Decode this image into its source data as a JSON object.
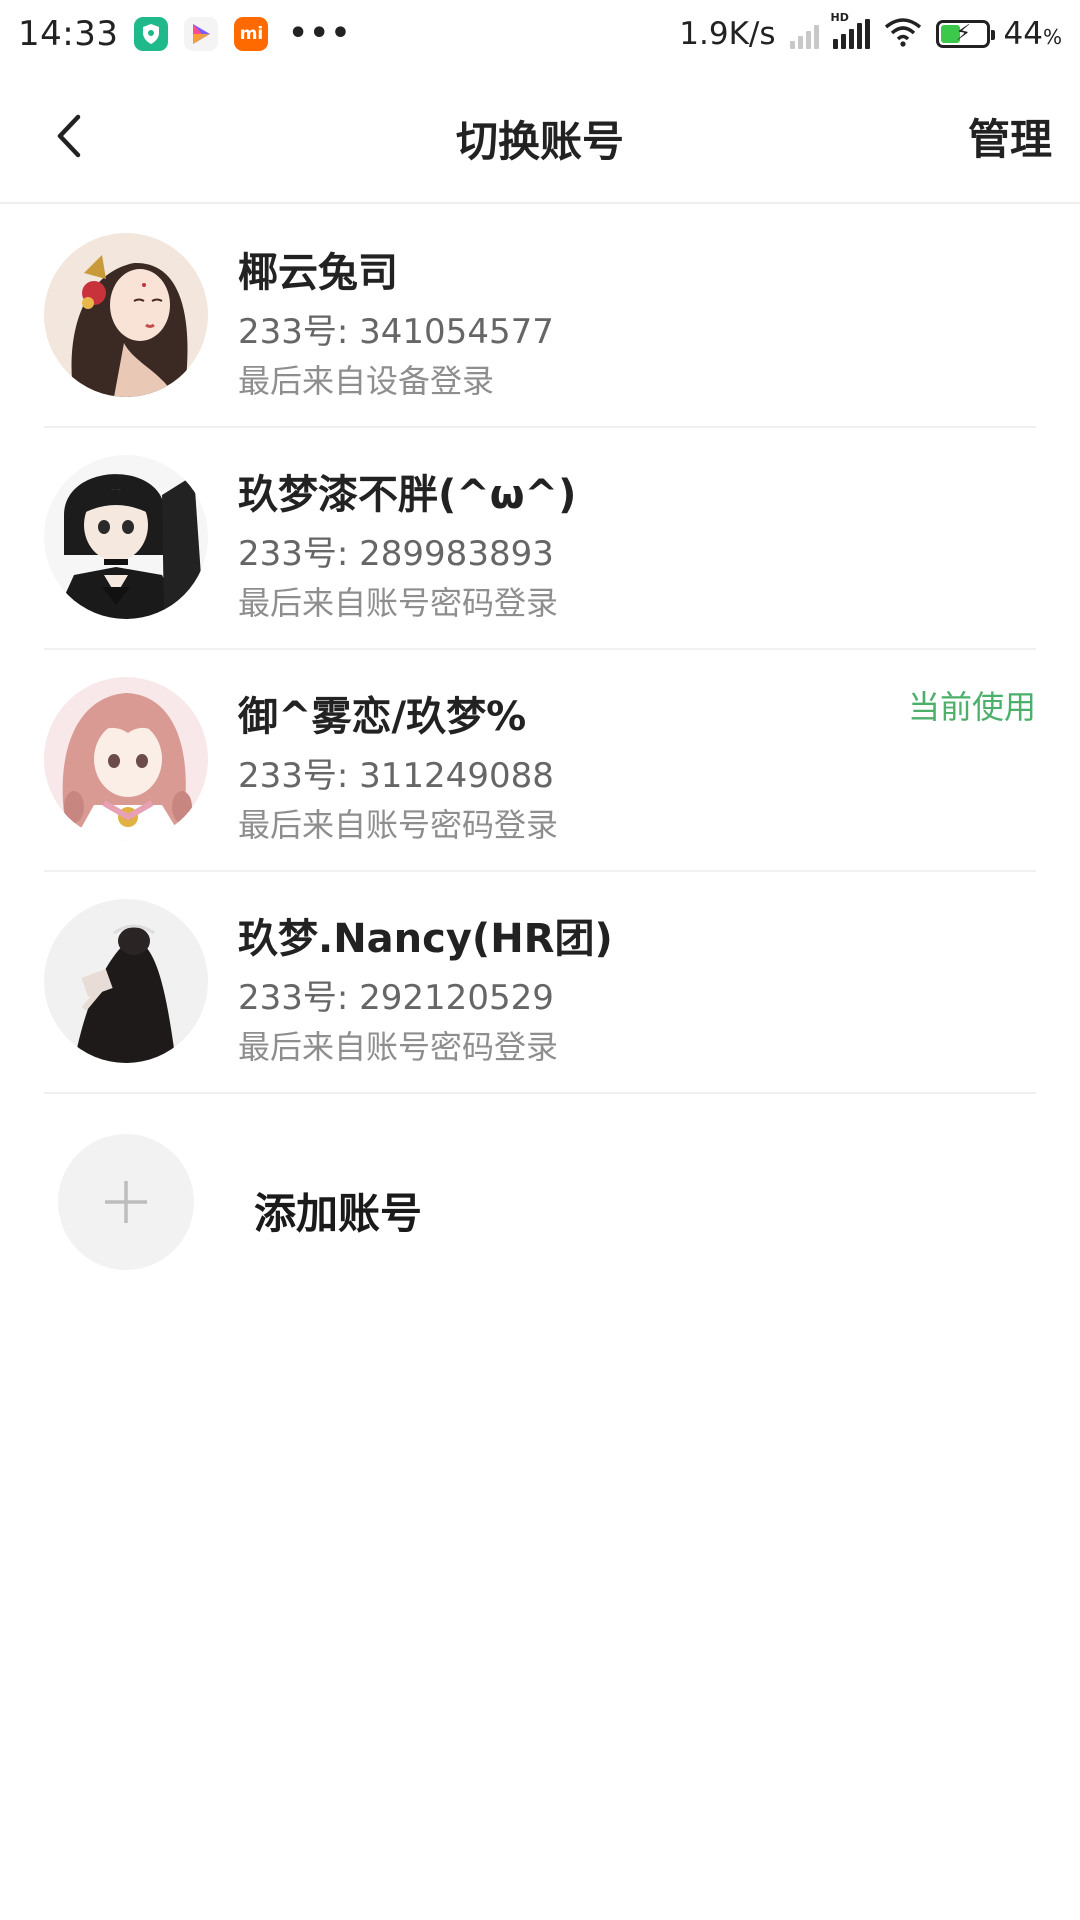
{
  "status_bar": {
    "time": "14:33",
    "speed": "1.9K/s",
    "battery_pct": "44",
    "battery_unit": "%",
    "battery_level": 0.44,
    "icons": [
      "shield-app-icon",
      "play-app-icon",
      "mi-app-icon",
      "more-dots-icon",
      "signal-icon",
      "hd-signal-icon",
      "wifi-icon",
      "battery-icon"
    ],
    "accent_green": "#3cc84a"
  },
  "header": {
    "title": "切换账号",
    "manage_label": "管理",
    "back_icon": "chevron-left-icon"
  },
  "accounts": [
    {
      "name": "椰云兔司",
      "id_line": "233号: 341054577",
      "last_login": "最后来自设备登录",
      "current": ""
    },
    {
      "name": "玖梦漆不胖(^ω^)",
      "id_line": "233号: 289983893",
      "last_login": "最后来自账号密码登录",
      "current": ""
    },
    {
      "name": "御^雾恋/玖梦%",
      "id_line": "233号: 311249088",
      "last_login": "最后来自账号密码登录",
      "current": "当前使用"
    },
    {
      "name": "玖梦.Nancy(HR团)",
      "id_line": "233号: 292120529",
      "last_login": "最后来自账号密码登录",
      "current": ""
    }
  ],
  "add_account": {
    "label": "添加账号",
    "icon": "plus-icon"
  },
  "colors": {
    "current_badge": "#4caf6a",
    "divider": "#f0f0f0"
  }
}
